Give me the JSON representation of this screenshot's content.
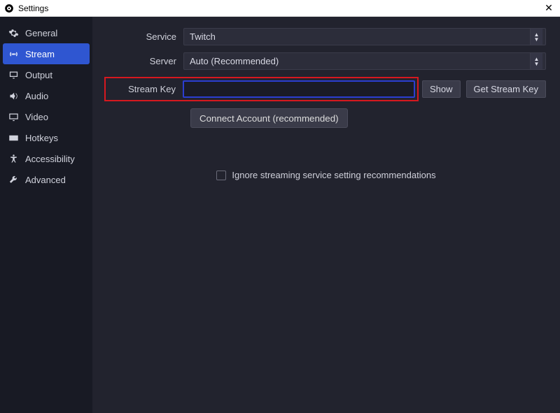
{
  "window": {
    "title": "Settings"
  },
  "sidebar": {
    "items": [
      {
        "label": "General",
        "icon": "gear",
        "active": false
      },
      {
        "label": "Stream",
        "icon": "broadcast",
        "active": true
      },
      {
        "label": "Output",
        "icon": "screen-out",
        "active": false
      },
      {
        "label": "Audio",
        "icon": "speaker",
        "active": false
      },
      {
        "label": "Video",
        "icon": "display",
        "active": false
      },
      {
        "label": "Hotkeys",
        "icon": "keyboard",
        "active": false
      },
      {
        "label": "Accessibility",
        "icon": "accessibility",
        "active": false
      },
      {
        "label": "Advanced",
        "icon": "tools",
        "active": false
      }
    ]
  },
  "form": {
    "service_label": "Service",
    "service_value": "Twitch",
    "server_label": "Server",
    "server_value": "Auto (Recommended)",
    "streamkey_label": "Stream Key",
    "streamkey_value": "",
    "show_button": "Show",
    "get_key_button": "Get Stream Key",
    "connect_button": "Connect Account (recommended)",
    "ignore_checkbox_label": "Ignore streaming service setting recommendations"
  }
}
